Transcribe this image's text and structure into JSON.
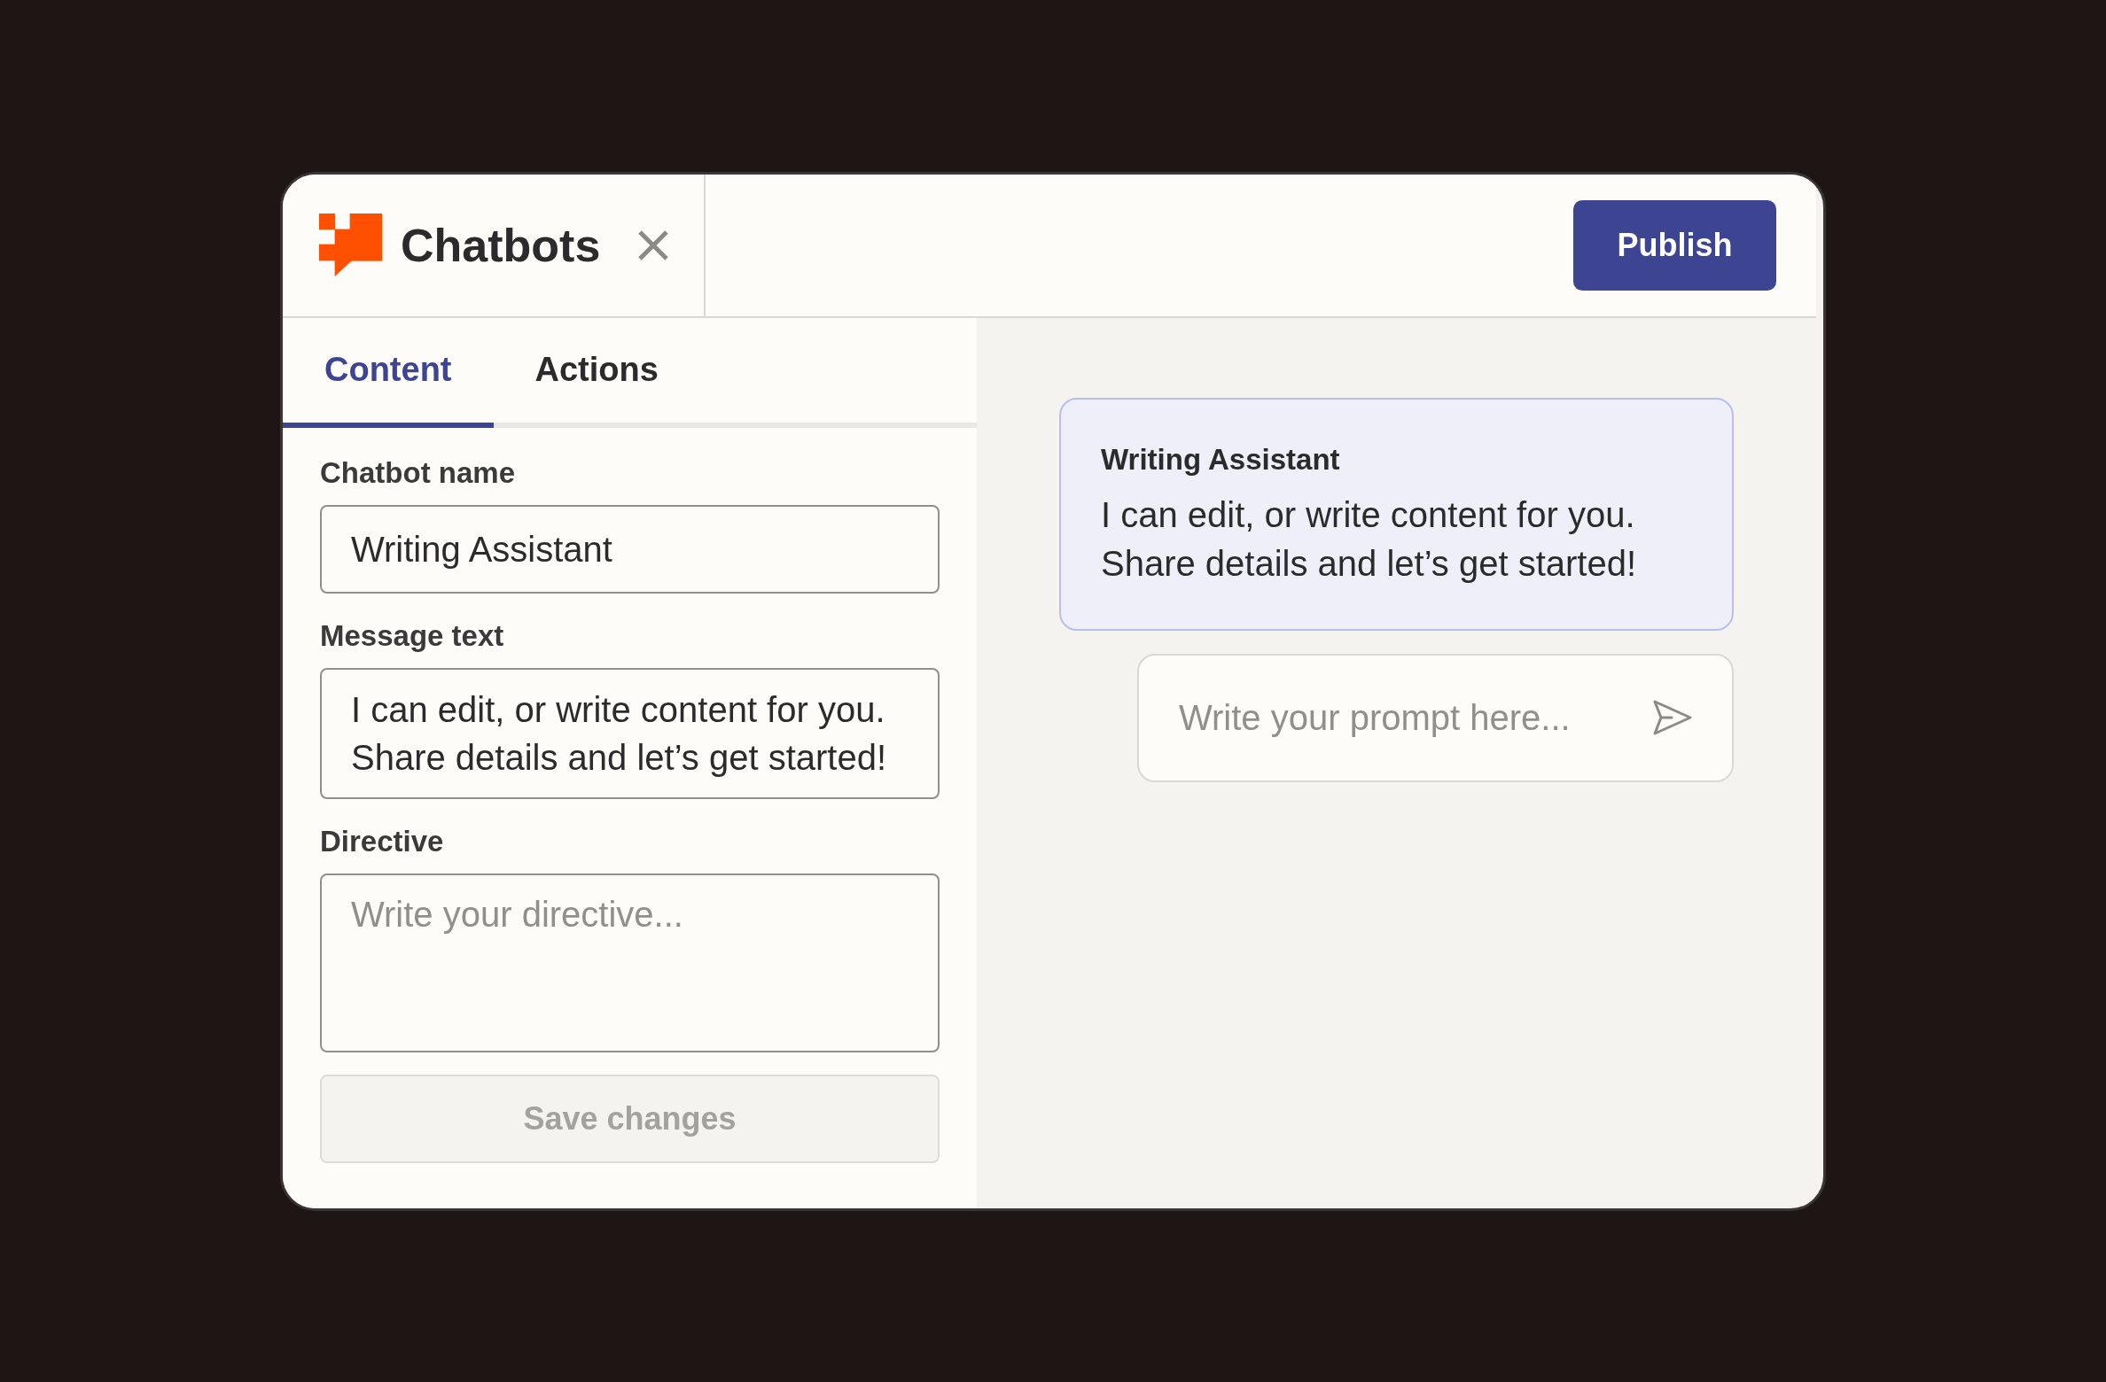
{
  "header": {
    "title": "Chatbots",
    "publish_button": "Publish"
  },
  "tabs": [
    {
      "label": "Content",
      "selected": true
    },
    {
      "label": "Actions",
      "selected": false
    }
  ],
  "form": {
    "fields": [
      {
        "label": "Chatbot name",
        "kind": "input",
        "value": "Writing Assistant"
      },
      {
        "label": "Message text",
        "kind": "textarea",
        "value": "I can edit, or write content for you. Share details and let’s get started!"
      },
      {
        "label": "Directive",
        "kind": "textarea",
        "placeholder": "Write your directive..."
      }
    ],
    "save_button": {
      "label": "Save changes",
      "disabled": true
    }
  },
  "preview": {
    "message": {
      "sender": "Writing Assistant",
      "text": "I can edit, or write content for you. Share details and let’s get started!"
    },
    "prompt": {
      "placeholder": "Write your prompt here..."
    }
  }
}
